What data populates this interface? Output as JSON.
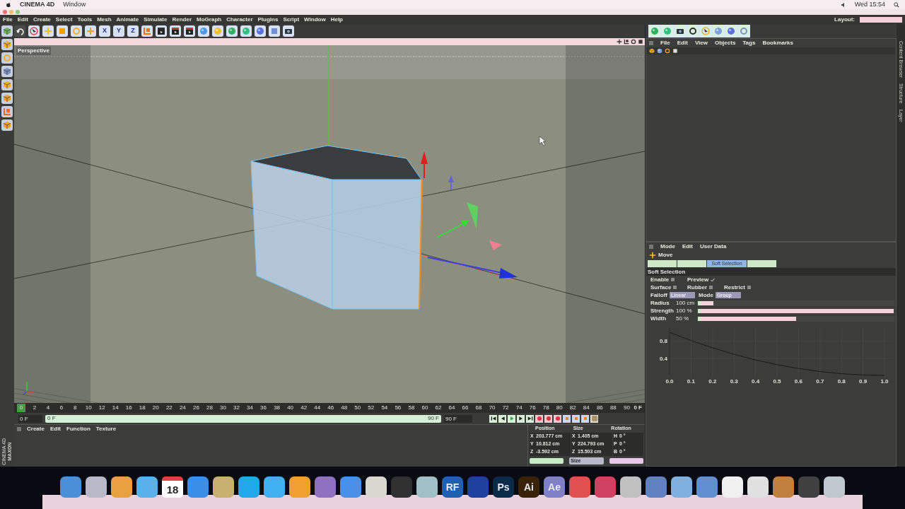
{
  "mac_menu_bar": {
    "app": "CINEMA 4D",
    "menus": [
      "Window"
    ],
    "clock": "Wed 15:54"
  },
  "menu_bar": [
    "File",
    "Edit",
    "Create",
    "Select",
    "Tools",
    "Mesh",
    "Animate",
    "Simulate",
    "Render",
    "MoGraph",
    "Character",
    "Plugins",
    "Script",
    "Window",
    "Help"
  ],
  "layout": {
    "label": "Layout:"
  },
  "toolbar": [
    {
      "kind": "undo"
    },
    {
      "kind": "pointer",
      "color": "#e04040"
    },
    {
      "kind": "move",
      "color": "#f0c020"
    },
    {
      "kind": "square",
      "color": "#f0a000"
    },
    {
      "kind": "ring",
      "color": "#f0b030"
    },
    {
      "kind": "move",
      "color": "#f0a020"
    },
    {
      "kind": "letter",
      "label": "X"
    },
    {
      "kind": "letter",
      "label": "Y"
    },
    {
      "kind": "letter",
      "label": "Z"
    },
    {
      "kind": "axis",
      "color": "#f07020"
    },
    {
      "kind": "clapper",
      "color": "#303030"
    },
    {
      "kind": "clapper",
      "color": "#d03030"
    },
    {
      "kind": "clapper",
      "color": "#d03030"
    },
    {
      "kind": "sphere",
      "color": "#4a9ae8"
    },
    {
      "kind": "sphere",
      "color": "#f0c030"
    },
    {
      "kind": "sphere",
      "color": "#30b060"
    },
    {
      "kind": "sphere",
      "color": "#30c080"
    },
    {
      "kind": "sphere",
      "color": "#5a70e0"
    },
    {
      "kind": "square",
      "color": "#7090d0"
    },
    {
      "kind": "camera",
      "color": "#303040"
    }
  ],
  "left_tools": [
    {
      "kind": "cube",
      "color": "#70b060"
    },
    {
      "kind": "cube",
      "color": "#f0b020"
    },
    {
      "kind": "ring",
      "color": "#f0b030"
    },
    {
      "kind": "cube",
      "color": "#8090c0"
    },
    {
      "kind": "cube",
      "color": "#f0b020"
    },
    {
      "kind": "cube",
      "color": "#f0a020"
    },
    {
      "kind": "axis",
      "color": "#f07020"
    },
    {
      "kind": "cube",
      "color": "#f0a020"
    }
  ],
  "right_toolbar": [
    {
      "kind": "sphere",
      "color": "#30b060"
    },
    {
      "kind": "sphere",
      "color": "#30c080"
    },
    {
      "kind": "camera",
      "color": "#303040"
    },
    {
      "kind": "ring",
      "color": "#303030"
    },
    {
      "kind": "pointer",
      "color": "#f0b020"
    },
    {
      "kind": "sphere",
      "color": "#80a0e0"
    },
    {
      "kind": "sphere",
      "color": "#5a70e0"
    },
    {
      "kind": "ring",
      "color": "#8090c0"
    }
  ],
  "viewport": {
    "title": "Perspective"
  },
  "timeline": {
    "ticks": [
      "0",
      "2",
      "4",
      "6",
      "8",
      "10",
      "12",
      "14",
      "16",
      "18",
      "20",
      "22",
      "24",
      "26",
      "28",
      "30",
      "32",
      "34",
      "36",
      "38",
      "40",
      "42",
      "44",
      "46",
      "48",
      "50",
      "52",
      "54",
      "56",
      "58",
      "60",
      "62",
      "64",
      "66",
      "68",
      "70",
      "72",
      "74",
      "76",
      "78",
      "80",
      "82",
      "84",
      "86",
      "88",
      "90"
    ],
    "current": "0 F",
    "start": "0 F",
    "range_start": "0 F",
    "range_end": "90 F",
    "end": "90 F"
  },
  "transport": [
    {
      "kind": "first"
    },
    {
      "kind": "prev"
    },
    {
      "kind": "play"
    },
    {
      "kind": "next"
    },
    {
      "kind": "last"
    },
    {
      "kind": "record"
    },
    {
      "kind": "record"
    },
    {
      "kind": "record"
    },
    {
      "kind": "key"
    },
    {
      "kind": "key"
    },
    {
      "kind": "key"
    },
    {
      "kind": "grid"
    }
  ],
  "material_manager": {
    "menus": [
      "Create",
      "Edit",
      "Function",
      "Texture"
    ]
  },
  "coordinates": {
    "headers": [
      "Position",
      "Size",
      "Rotation"
    ],
    "rows": [
      [
        [
          "X",
          "203.777 cm"
        ],
        [
          "X",
          "1.405 cm"
        ],
        [
          "H",
          "0 °"
        ]
      ],
      [
        [
          "Y",
          "10.812 cm"
        ],
        [
          "Y",
          "224.793 cm"
        ],
        [
          "P",
          "0 °"
        ]
      ],
      [
        [
          "Z",
          "-3.592 cm"
        ],
        [
          "Z",
          "15.503 cm"
        ],
        [
          "B",
          "0 °"
        ]
      ]
    ],
    "buttons": [
      {
        "kind": "button"
      },
      {
        "kind": "dropdown",
        "label": "Size"
      },
      {
        "kind": "button"
      }
    ]
  },
  "object_manager": {
    "menus": [
      "File",
      "Edit",
      "View",
      "Objects",
      "Tags",
      "Bookmarks"
    ]
  },
  "attributes": {
    "menus": [
      "Mode",
      "Edit",
      "User Data"
    ],
    "tool": "Move",
    "tabs": [
      {
        "selected": false
      },
      {
        "selected": false
      },
      {
        "label": "Soft Selection",
        "selected": true
      },
      {
        "selected": false
      }
    ],
    "section": "Soft Selection",
    "checkbox_rows": [
      [
        {
          "label": "Enable",
          "checked": false
        },
        {
          "label": "Preview",
          "checked": true
        }
      ],
      [
        {
          "label": "Surface",
          "checked": false
        },
        {
          "label": "Rubber",
          "checked": false
        },
        {
          "label": "Restrict",
          "checked": false
        }
      ]
    ],
    "dropdowns": [
      {
        "label": "Falloff",
        "value": "Linear"
      },
      {
        "label": "Mode",
        "value": "Group"
      }
    ],
    "sliders": [
      {
        "label": "Radius",
        "reading": "100 cm",
        "level": 0.08
      },
      {
        "label": "Strength",
        "reading": "100 %",
        "level": 1
      },
      {
        "label": "Width",
        "reading": "50 %",
        "level": 0.5
      }
    ],
    "chart_data": {
      "type": "line",
      "grid": true,
      "x": [
        0,
        0.1,
        0.2,
        0.3,
        0.4,
        0.5,
        0.6,
        0.7,
        0.8,
        0.9,
        1
      ],
      "series": [
        {
          "color": "#1a1a1a",
          "values": [
            1,
            0.81,
            0.64,
            0.49,
            0.36,
            0.25,
            0.16,
            0.09,
            0.04,
            0.01,
            0
          ]
        }
      ],
      "xlim": [
        0,
        1
      ],
      "ylim": [
        0,
        1.1
      ],
      "xticks": [
        {
          "value": 0,
          "label": "0.0"
        },
        {
          "value": 0.1,
          "label": "0.1"
        },
        {
          "value": 0.2,
          "label": "0.2"
        },
        {
          "value": 0.3,
          "label": "0.3"
        },
        {
          "value": 0.4,
          "label": "0.4"
        },
        {
          "value": 0.5,
          "label": "0.5"
        },
        {
          "value": 0.6,
          "label": "0.6"
        },
        {
          "value": 0.7,
          "label": "0.7"
        },
        {
          "value": 0.8,
          "label": "0.8"
        },
        {
          "value": 0.9,
          "label": "0.9"
        },
        {
          "value": 1,
          "label": "1.0"
        }
      ],
      "yticks": [
        {
          "value": 0.4,
          "label": "0.4"
        },
        {
          "value": 0.8,
          "label": "0.8"
        }
      ]
    }
  },
  "side_tabs": [
    "Content Browser",
    "Structure",
    "Layer"
  ],
  "logo": {
    "brand": "MAXON",
    "product": "CINEMA 4D"
  },
  "dock": [
    {
      "kind": "app",
      "color": "#4a8fd8"
    },
    {
      "kind": "app",
      "color": "#b8b8c8"
    },
    {
      "kind": "app",
      "color": "#e8a040"
    },
    {
      "kind": "app",
      "color": "#5ab0e8"
    },
    {
      "kind": "calendar",
      "label": "18",
      "color": "#ffffff"
    },
    {
      "kind": "app",
      "color": "#3a8ee8"
    },
    {
      "kind": "app",
      "color": "#c8b070"
    },
    {
      "kind": "app",
      "color": "#20a8e8"
    },
    {
      "kind": "app",
      "color": "#40b0f0"
    },
    {
      "kind": "app",
      "color": "#f0a030"
    },
    {
      "kind": "app",
      "color": "#9070c0"
    },
    {
      "kind": "app",
      "color": "#4a90e8"
    },
    {
      "kind": "app",
      "color": "#d8d8d0"
    },
    {
      "kind": "app",
      "color": "#303030"
    },
    {
      "kind": "app",
      "color": "#a0c0c8"
    },
    {
      "kind": "app",
      "label": "RF",
      "color": "#2060b0"
    },
    {
      "kind": "app",
      "color": "#2040a0"
    },
    {
      "kind": "app",
      "label": "Ps",
      "color": "#0a2a4a"
    },
    {
      "kind": "app",
      "label": "Ai",
      "color": "#3a2208"
    },
    {
      "kind": "app",
      "label": "Ae",
      "color": "#8080c8"
    },
    {
      "kind": "app",
      "color": "#e05050"
    },
    {
      "kind": "app",
      "color": "#d04060"
    },
    {
      "kind": "app",
      "color": "#c0c0c0"
    },
    {
      "kind": "app",
      "color": "#6080c0"
    },
    {
      "kind": "app",
      "color": "#80b0e0"
    },
    {
      "kind": "app",
      "color": "#6090d0"
    },
    {
      "kind": "app",
      "color": "#f0f0f0"
    },
    {
      "kind": "app",
      "color": "#e0e0e0"
    },
    {
      "kind": "app",
      "color": "#c08040"
    },
    {
      "kind": "app",
      "color": "#404040"
    },
    {
      "kind": "app",
      "color": "#c0c8d0"
    }
  ]
}
